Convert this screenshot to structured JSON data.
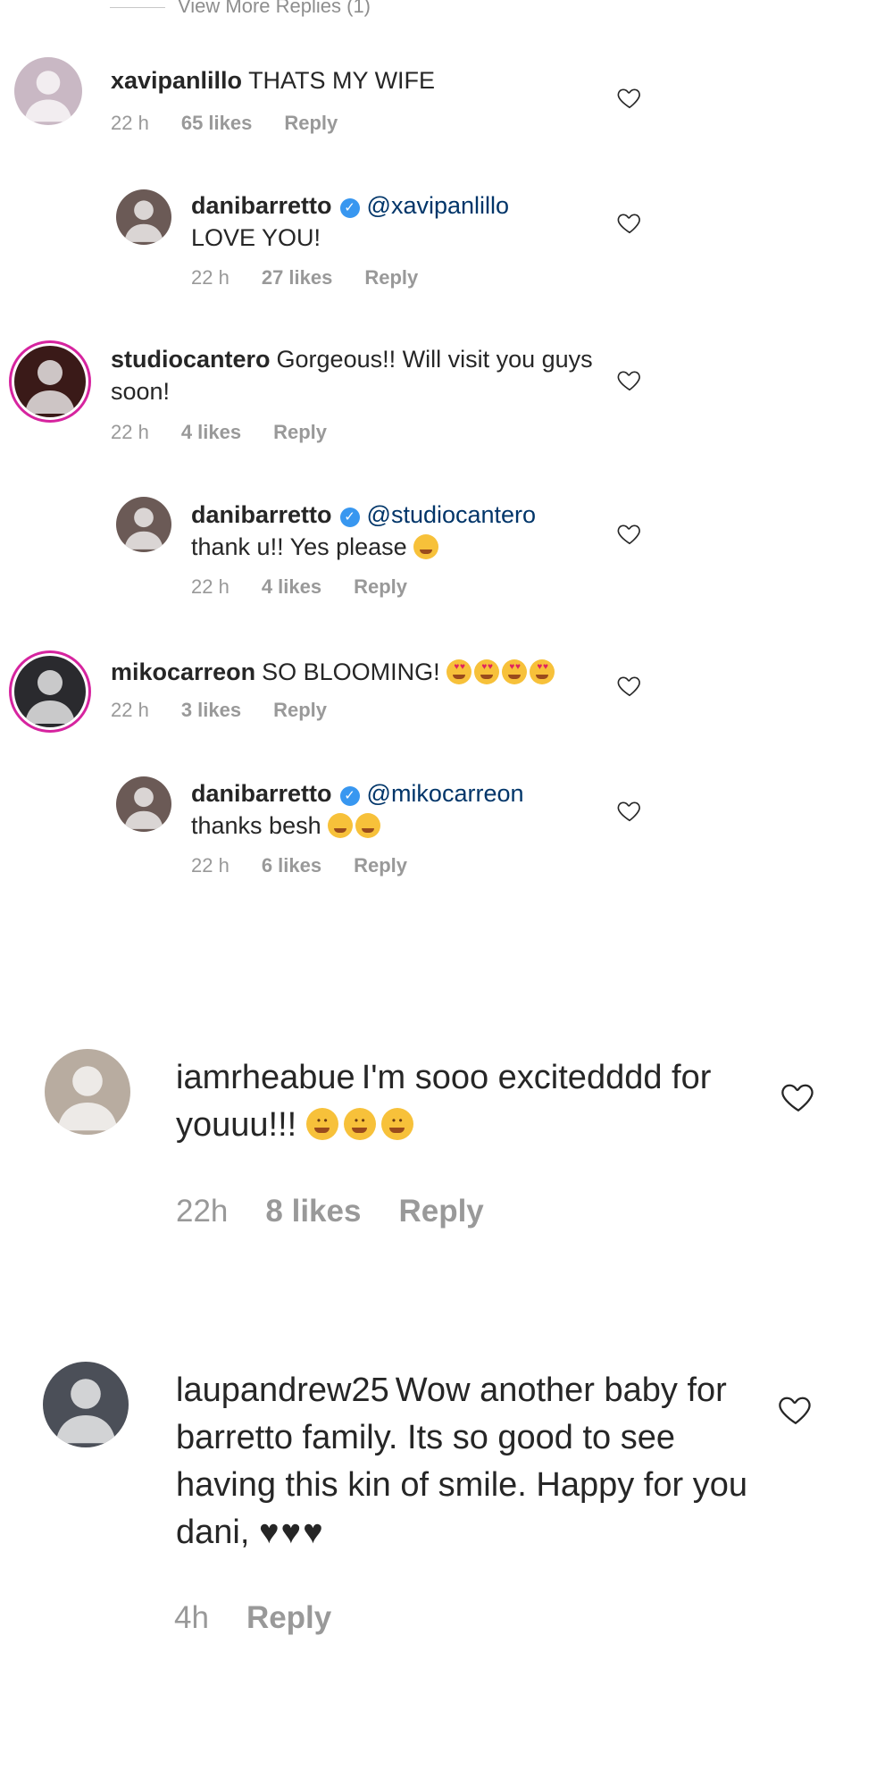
{
  "view_more": "View More Replies (1)",
  "comments": [
    {
      "user": "xavipanlillo",
      "text": "THATS MY WIFE",
      "time": "22 h",
      "likes": "65 likes",
      "reply": "Reply"
    },
    {
      "user": "danibarretto",
      "mention": "@xavipanlillo",
      "text": "LOVE YOU!",
      "time": "22 h",
      "likes": "27 likes",
      "reply": "Reply"
    },
    {
      "user": "studiocantero",
      "text": "Gorgeous!! Will visit you guys soon!",
      "time": "22 h",
      "likes": "4 likes",
      "reply": "Reply"
    },
    {
      "user": "danibarretto",
      "mention": "@studiocantero",
      "text": "thank u!! Yes please",
      "time": "22 h",
      "likes": "4 likes",
      "reply": "Reply"
    },
    {
      "user": "mikocarreon",
      "text": "SO BLOOMING!",
      "time": "22 h",
      "likes": "3 likes",
      "reply": "Reply"
    },
    {
      "user": "danibarretto",
      "mention": "@mikocarreon",
      "text": "thanks besh",
      "time": "22 h",
      "likes": "6 likes",
      "reply": "Reply"
    },
    {
      "user": "iamrheabue",
      "text": "I'm sooo excitedddd for youuu!!!",
      "time": "22h",
      "likes": "8 likes",
      "reply": "Reply"
    },
    {
      "user": "laupandrew25",
      "text": "Wow another baby for barretto family. Its so good to see having this kin of smile. Happy for you dani,",
      "hearts": "♥♥♥",
      "time": "4h",
      "reply": "Reply"
    }
  ],
  "colors": {
    "accent": "#3897f0",
    "mention": "#003569",
    "meta": "#999999",
    "ring": "#d6249f"
  },
  "icons": {
    "like": "heart-outline-icon",
    "verified": "verified-badge-icon"
  }
}
